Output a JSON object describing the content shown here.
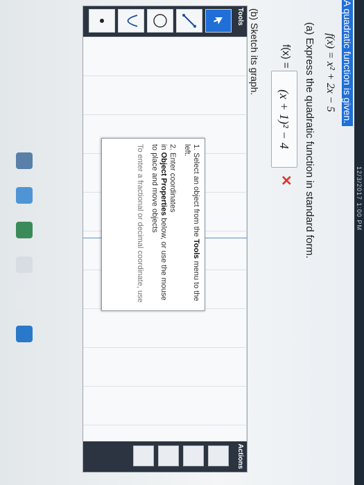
{
  "header": {
    "title": "A quadratic function is given.",
    "clock": "12/3/2017 1:00 PM"
  },
  "problem": {
    "function": "f(x) = x² + 2x − 5",
    "part_a": "(a) Express the quadratic function in standard form.",
    "fx_label": "f(x) =",
    "answer": "(x + 1)² − 4",
    "part_b": "(b) Sketch its graph."
  },
  "tools": {
    "title": "Tools",
    "items": [
      "pointer-icon",
      "line-icon",
      "circle-icon",
      "parabola-icon",
      "point-icon"
    ]
  },
  "actions": {
    "title": "Actions"
  },
  "tooltip": {
    "step1": "1. Select an object from the",
    "step1_bold": "Tools",
    "step1_rest": "menu to the left.",
    "step2": "2. Enter coordinates",
    "step2_in": "in",
    "step2_bold": "Object Properties",
    "step2_rest": "below, or use the mouse to place and move objects",
    "step3": "To enter a fractional or decimal coordinate, use"
  },
  "colors": {
    "accent": "#1f6fd6",
    "error": "#e0352b"
  }
}
